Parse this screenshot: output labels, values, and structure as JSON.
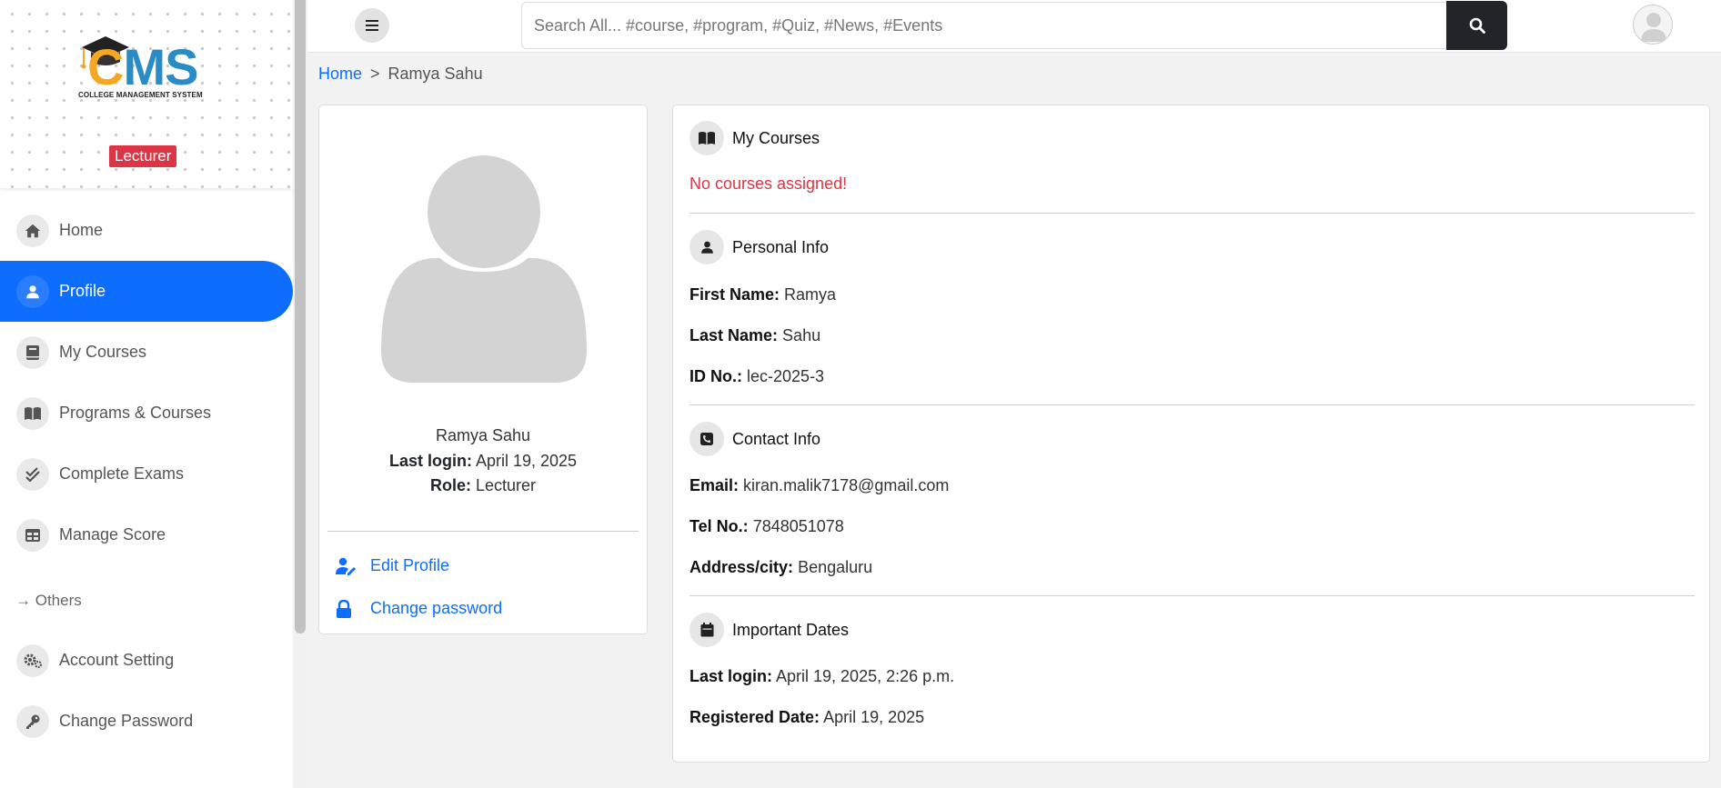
{
  "sidebar": {
    "logo_text_c": "C",
    "logo_text_ms": "MS",
    "logo_subtitle": "COLLEGE MANAGEMENT SYSTEM",
    "role_badge": "Lecturer",
    "items": [
      {
        "label": "Home",
        "icon": "home-icon"
      },
      {
        "label": "Profile",
        "icon": "user-icon",
        "active": true
      },
      {
        "label": "My Courses",
        "icon": "book-icon"
      },
      {
        "label": "Programs & Courses",
        "icon": "book-open-icon"
      },
      {
        "label": "Complete Exams",
        "icon": "check-double-icon"
      },
      {
        "label": "Manage Score",
        "icon": "table-icon"
      }
    ],
    "others_label": "→ Others",
    "other_items": [
      {
        "label": "Account Setting",
        "icon": "gears-icon"
      },
      {
        "label": "Change Password",
        "icon": "key-icon"
      }
    ]
  },
  "topbar": {
    "search_placeholder": "Search All... #course, #program, #Quiz, #News, #Events"
  },
  "breadcrumb": {
    "home": "Home",
    "separator": ">",
    "current": "Ramya Sahu"
  },
  "profile_card": {
    "name": "Ramya Sahu",
    "last_login_label": "Last login:",
    "last_login_value": "April 19, 2025",
    "role_label": "Role:",
    "role_value": "Lecturer",
    "edit_profile": "Edit Profile",
    "change_password": "Change password"
  },
  "info": {
    "courses": {
      "title": "My Courses",
      "empty_message": "No courses assigned!"
    },
    "personal": {
      "title": "Personal Info",
      "first_name_label": "First Name:",
      "first_name": "Ramya",
      "last_name_label": "Last Name:",
      "last_name": "Sahu",
      "id_label": "ID No.:",
      "id": "lec-2025-3"
    },
    "contact": {
      "title": "Contact Info",
      "email_label": "Email:",
      "email": "kiran.malik7178@gmail.com",
      "tel_label": "Tel No.:",
      "tel": "7848051078",
      "address_label": "Address/city:",
      "address": "Bengaluru"
    },
    "dates": {
      "title": "Important Dates",
      "last_login_label": "Last login:",
      "last_login": "April 19, 2025, 2:26 p.m.",
      "registered_label": "Registered Date:",
      "registered": "April 19, 2025"
    }
  },
  "colors": {
    "primary": "#0d6efd",
    "danger": "#dc3545",
    "dark": "#212529",
    "logo_orange": "#f5a623",
    "logo_blue": "#2a8cc4"
  }
}
